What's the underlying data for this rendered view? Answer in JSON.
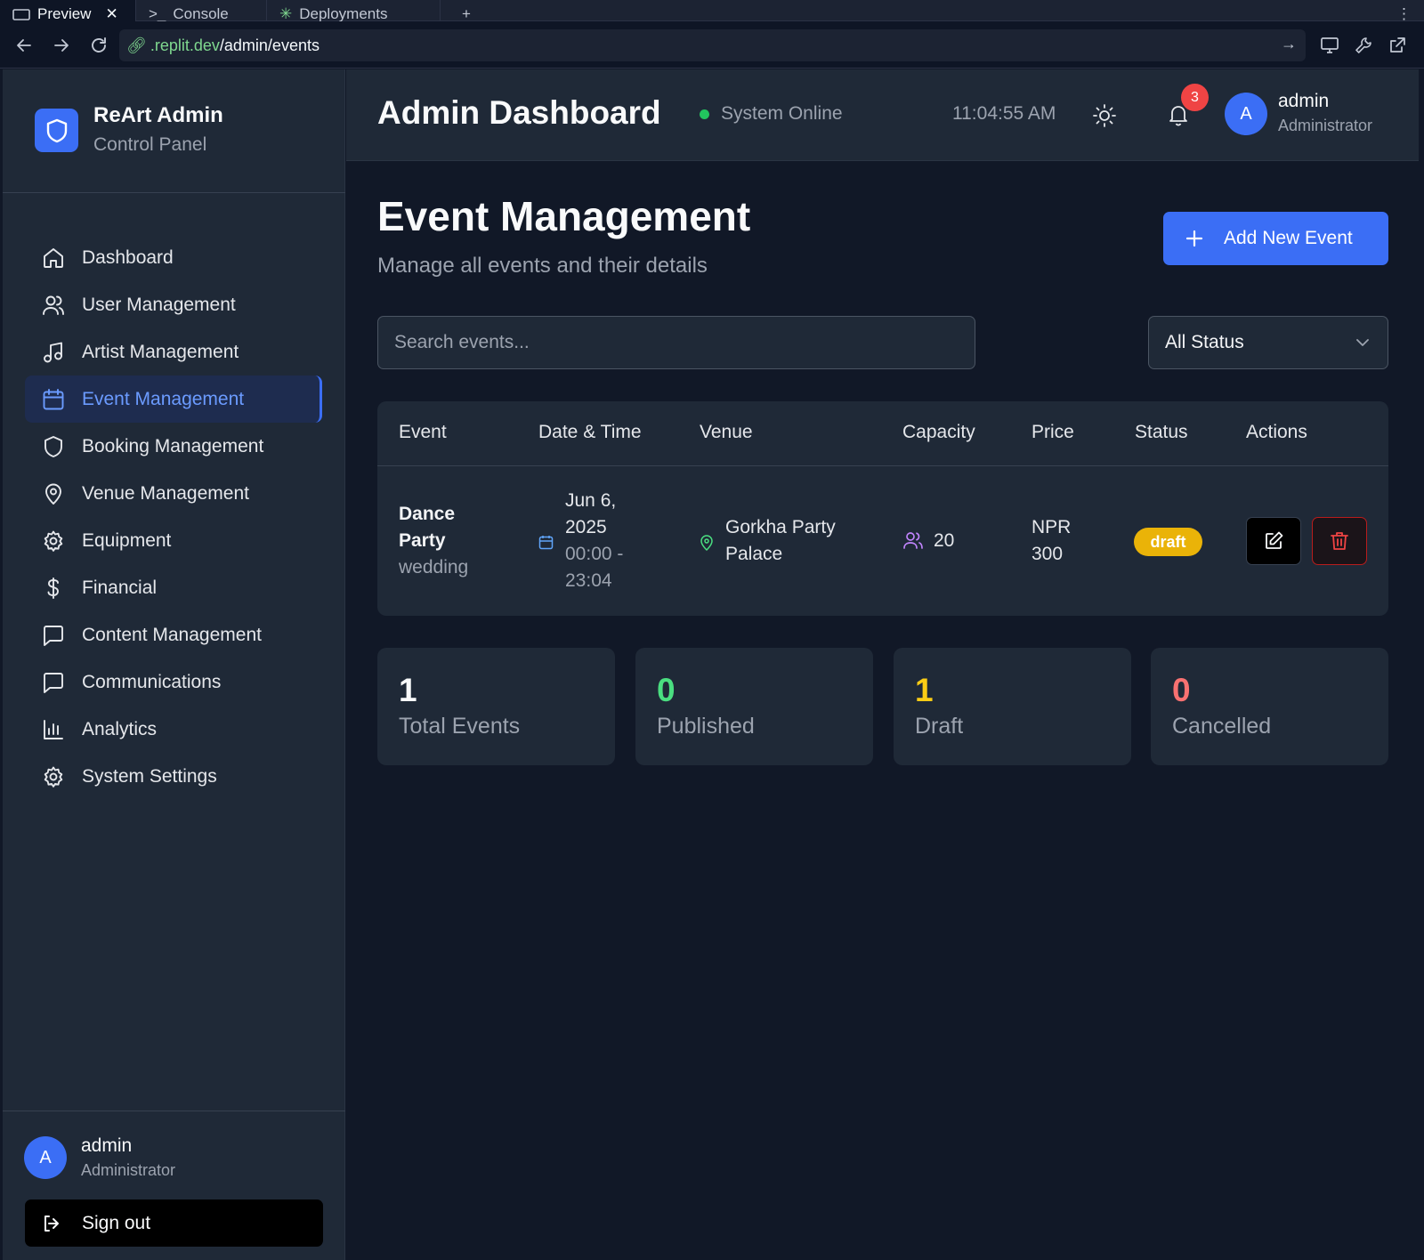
{
  "browser": {
    "tabs": [
      {
        "label": "Preview",
        "active": true
      },
      {
        "label": "Console",
        "active": false
      },
      {
        "label": "Deployments",
        "active": false
      }
    ],
    "url_domain": ".replit.dev",
    "url_path": "/admin/events"
  },
  "sidebar": {
    "brand_title": "ReArt Admin",
    "brand_subtitle": "Control Panel",
    "items": [
      {
        "label": "Dashboard",
        "icon": "home-icon"
      },
      {
        "label": "User Management",
        "icon": "users-icon"
      },
      {
        "label": "Artist Management",
        "icon": "music-icon"
      },
      {
        "label": "Event Management",
        "icon": "calendar-icon",
        "active": true
      },
      {
        "label": "Booking Management",
        "icon": "shield-icon"
      },
      {
        "label": "Venue Management",
        "icon": "map-pin-icon"
      },
      {
        "label": "Equipment",
        "icon": "gear-icon"
      },
      {
        "label": "Financial",
        "icon": "dollar-icon"
      },
      {
        "label": "Content Management",
        "icon": "message-icon"
      },
      {
        "label": "Communications",
        "icon": "message-icon"
      },
      {
        "label": "Analytics",
        "icon": "bar-chart-icon"
      },
      {
        "label": "System Settings",
        "icon": "gear-icon"
      }
    ],
    "user": {
      "initial": "A",
      "name": "admin",
      "role": "Administrator"
    },
    "signout_label": "Sign out"
  },
  "header": {
    "title": "Admin Dashboard",
    "status": "System Online",
    "time": "11:04:55 AM",
    "notifications": "3",
    "user": {
      "initial": "A",
      "name": "admin",
      "role": "Administrator"
    }
  },
  "main": {
    "title": "Event Management",
    "subtitle": "Manage all events and their details",
    "add_button": "Add New Event",
    "search_placeholder": "Search events...",
    "status_filter": "All Status",
    "columns": [
      "Event",
      "Date & Time",
      "Venue",
      "Capacity",
      "Price",
      "Status",
      "Actions"
    ],
    "rows": [
      {
        "event_name_1": "Dance",
        "event_name_2": "Party",
        "category": "wedding",
        "date_1": "Jun 6,",
        "date_2": "2025",
        "time_1": "00:00 -",
        "time_2": "23:04",
        "venue_1": "Gorkha Party",
        "venue_2": "Palace",
        "capacity": "20",
        "price_1": "NPR",
        "price_2": "300",
        "status": "draft"
      }
    ],
    "stats": [
      {
        "value": "1",
        "label": "Total Events",
        "color": "#f9fafb"
      },
      {
        "value": "0",
        "label": "Published",
        "color": "#4ade80"
      },
      {
        "value": "1",
        "label": "Draft",
        "color": "#facc15"
      },
      {
        "value": "0",
        "label": "Cancelled",
        "color": "#f87171"
      }
    ]
  },
  "colors": {
    "accent": "#3b6ef5",
    "bg": "#111827",
    "panel": "#1f2937",
    "draft": "#eab308",
    "danger": "#ef4444"
  }
}
